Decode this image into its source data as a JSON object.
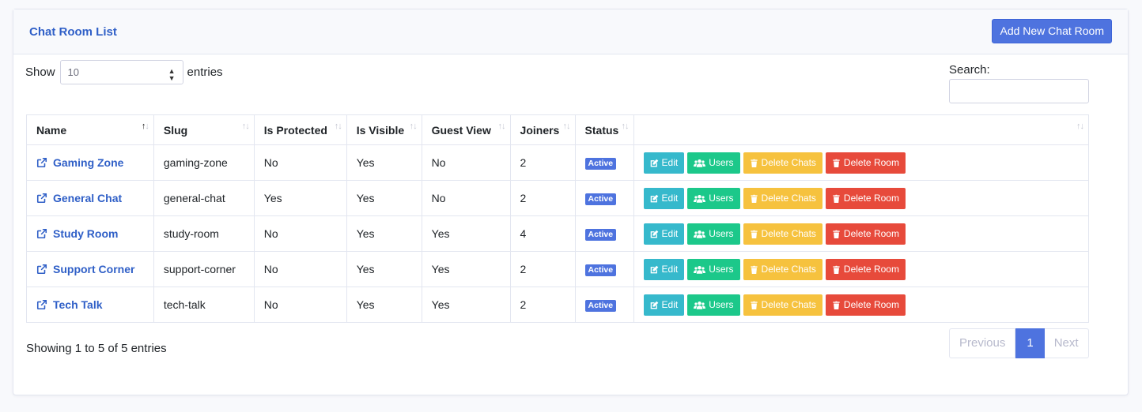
{
  "card": {
    "title": "Chat Room List",
    "add_button": "Add New Chat Room"
  },
  "length": {
    "show": "Show",
    "value": "10",
    "entries": "entries"
  },
  "search": {
    "label": "Search:",
    "value": ""
  },
  "table": {
    "headers": [
      "Name",
      "Slug",
      "Is Protected",
      "Is Visible",
      "Guest View",
      "Joiners",
      "Status",
      ""
    ],
    "rows": [
      {
        "name": "Gaming Zone",
        "slug": "gaming-zone",
        "protected": "No",
        "visible": "Yes",
        "guest": "No",
        "joiners": "2",
        "status": "Active"
      },
      {
        "name": "General Chat",
        "slug": "general-chat",
        "protected": "Yes",
        "visible": "Yes",
        "guest": "No",
        "joiners": "2",
        "status": "Active"
      },
      {
        "name": "Study Room",
        "slug": "study-room",
        "protected": "No",
        "visible": "Yes",
        "guest": "Yes",
        "joiners": "4",
        "status": "Active"
      },
      {
        "name": "Support Corner",
        "slug": "support-corner",
        "protected": "No",
        "visible": "Yes",
        "guest": "Yes",
        "joiners": "2",
        "status": "Active"
      },
      {
        "name": "Tech Talk",
        "slug": "tech-talk",
        "protected": "No",
        "visible": "Yes",
        "guest": "Yes",
        "joiners": "2",
        "status": "Active"
      }
    ],
    "actions": {
      "edit": "Edit",
      "users": "Users",
      "delete_chats": "Delete Chats",
      "delete_room": "Delete Room"
    }
  },
  "footer": {
    "info": "Showing 1 to 5 of 5 entries",
    "previous": "Previous",
    "page": "1",
    "next": "Next"
  },
  "colors": {
    "primary": "#4e73df",
    "info": "#36b9cc",
    "success": "#1cc88a",
    "warning": "#f6c23e",
    "danger": "#e74a3b"
  }
}
